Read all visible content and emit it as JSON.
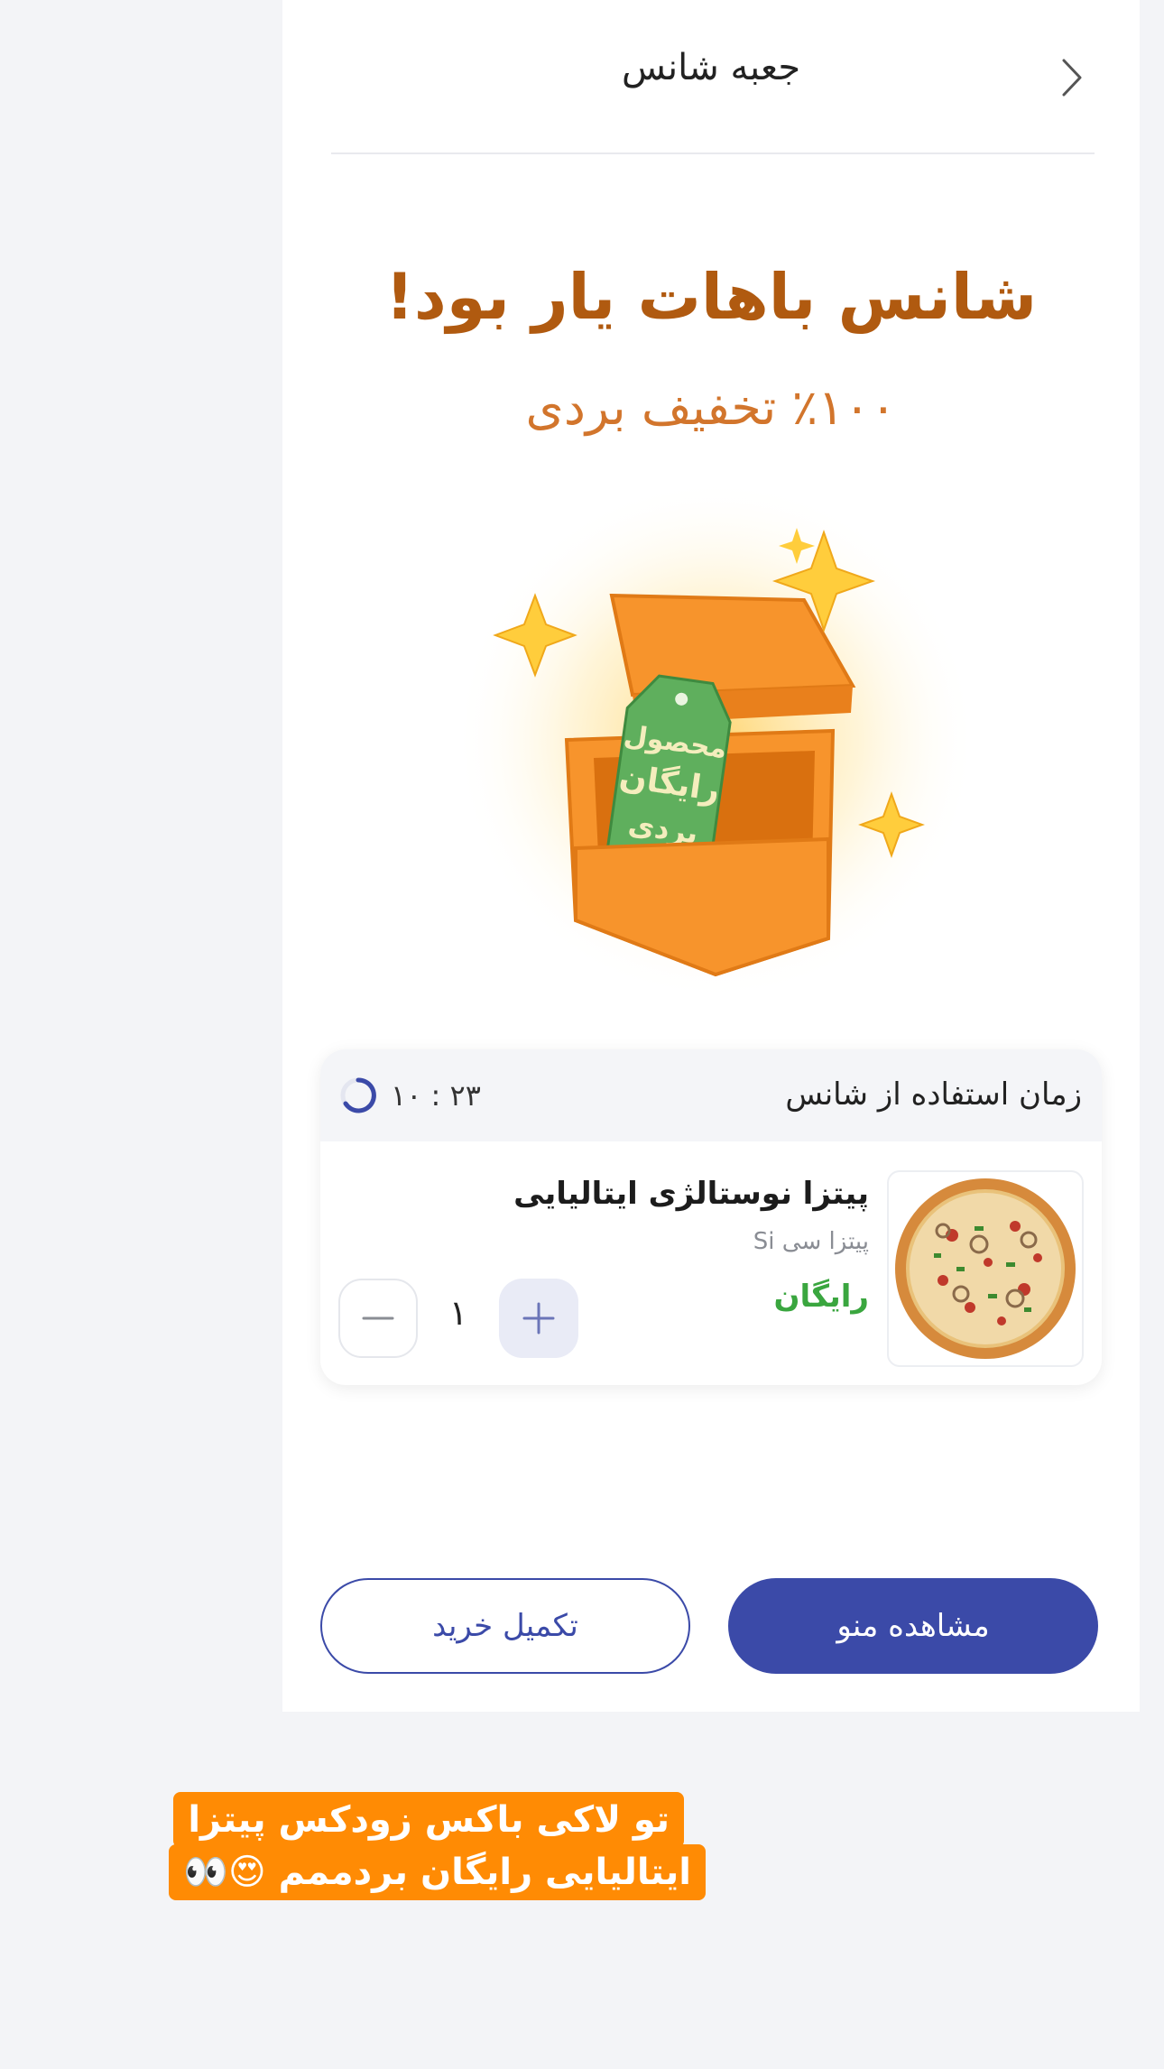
{
  "header": {
    "title": "جعبه شانس"
  },
  "hero": {
    "title": "شانس باهات یار بود!",
    "subtitle": "٪۱۰۰ تخفیف بردی",
    "tag_lines": [
      "محصول",
      "رایگان",
      "بردی"
    ]
  },
  "card": {
    "time_label": "زمان استفاده از شانس",
    "timer": "۱۰ : ۲۳",
    "product": {
      "name": "پیتزا نوستالژی ایتالیایی",
      "category": "پیتزا سی Si",
      "price": "رایگان",
      "quantity": "۱"
    }
  },
  "actions": {
    "view_menu": "مشاهده منو",
    "checkout": "تکمیل خرید"
  },
  "caption": {
    "line1": "تو لاکی باکس زودکس پیتزا",
    "line2": "ایتالیایی رایگان بردممم 😍👀"
  },
  "colors": {
    "primary": "#3b4aa8",
    "accent_orange": "#ff8b04",
    "title_brown": "#b05a10",
    "free_green": "#3aa63f"
  }
}
